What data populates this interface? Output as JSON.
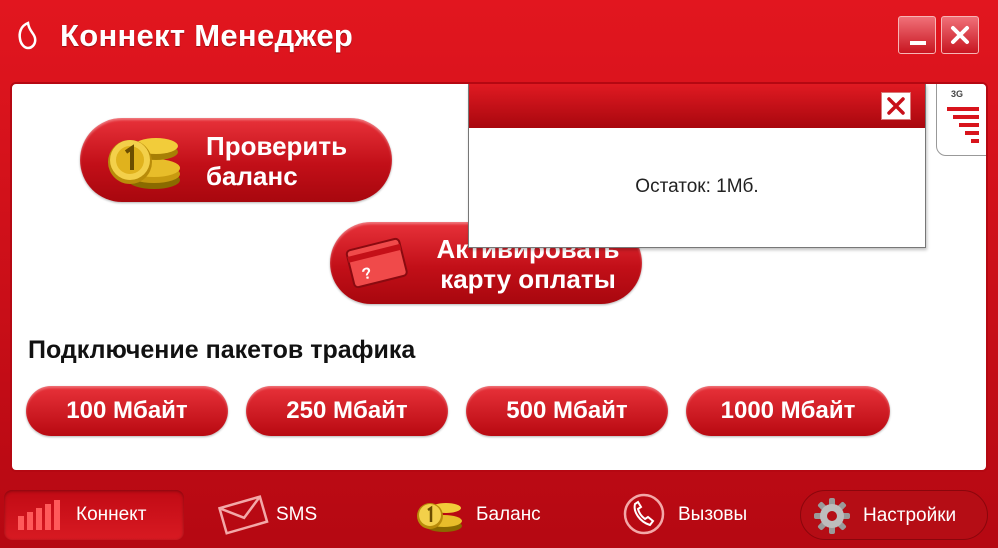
{
  "app": {
    "title": "Коннект Менеджер",
    "icons": {
      "logo": "vodafone-logo-icon",
      "minimize": "minimize-icon",
      "close": "close-icon"
    }
  },
  "main": {
    "check_balance": {
      "label": "Проверить баланс",
      "icon": "coins-icon"
    },
    "activate_card": {
      "label": "Активировать карту оплаты",
      "icon": "payment-card-icon"
    },
    "packages": {
      "title": "Подключение пакетов трафика",
      "items": [
        "100 Мбайт",
        "250 Мбайт",
        "500 Мбайт",
        "1000 Мбайт"
      ]
    }
  },
  "popup": {
    "message": "Остаток: 1Мб.",
    "close_icon": "close-icon"
  },
  "signal": {
    "network": "3G",
    "icon": "signal-strength-icon"
  },
  "tabs": [
    {
      "label": "Коннект",
      "icon": "signal-bars-icon",
      "active": true
    },
    {
      "label": "SMS",
      "icon": "envelope-icon",
      "active": false
    },
    {
      "label": "Баланс",
      "icon": "coins-icon",
      "active": false
    },
    {
      "label": "Вызовы",
      "icon": "phone-icon",
      "active": false
    },
    {
      "label": "Настройки",
      "icon": "gear-icon",
      "active": false
    }
  ],
  "colors": {
    "brand": "#e2161f",
    "brand_dark": "#a8070e",
    "text": "#111111"
  }
}
